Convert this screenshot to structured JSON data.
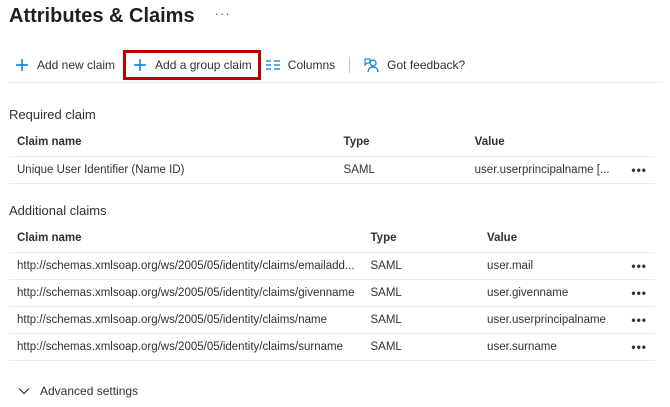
{
  "header": {
    "title": "Attributes & Claims",
    "more": "···"
  },
  "toolbar": {
    "add_new_claim": "Add new claim",
    "add_group_claim": "Add a group claim",
    "columns": "Columns",
    "feedback": "Got feedback?"
  },
  "required": {
    "section_title": "Required claim",
    "columns": {
      "name": "Claim name",
      "type": "Type",
      "value": "Value"
    },
    "rows": [
      {
        "name": "Unique User Identifier (Name ID)",
        "type": "SAML",
        "value": "user.userprincipalname [..."
      }
    ]
  },
  "additional": {
    "section_title": "Additional claims",
    "columns": {
      "name": "Claim name",
      "type": "Type",
      "value": "Value"
    },
    "rows": [
      {
        "name": "http://schemas.xmlsoap.org/ws/2005/05/identity/claims/emailadd...",
        "type": "SAML",
        "value": "user.mail"
      },
      {
        "name": "http://schemas.xmlsoap.org/ws/2005/05/identity/claims/givenname",
        "type": "SAML",
        "value": "user.givenname"
      },
      {
        "name": "http://schemas.xmlsoap.org/ws/2005/05/identity/claims/name",
        "type": "SAML",
        "value": "user.userprincipalname"
      },
      {
        "name": "http://schemas.xmlsoap.org/ws/2005/05/identity/claims/surname",
        "type": "SAML",
        "value": "user.surname"
      }
    ]
  },
  "row_more": "•••",
  "advanced": {
    "label": "Advanced settings"
  },
  "colors": {
    "accent": "#0078d4",
    "highlight_border": "#c00000",
    "divider": "#edebe9"
  },
  "icons": {
    "add": "plus-icon",
    "columns": "columns-icon",
    "feedback": "feedback-icon",
    "advanced": "chevron-down-icon"
  }
}
